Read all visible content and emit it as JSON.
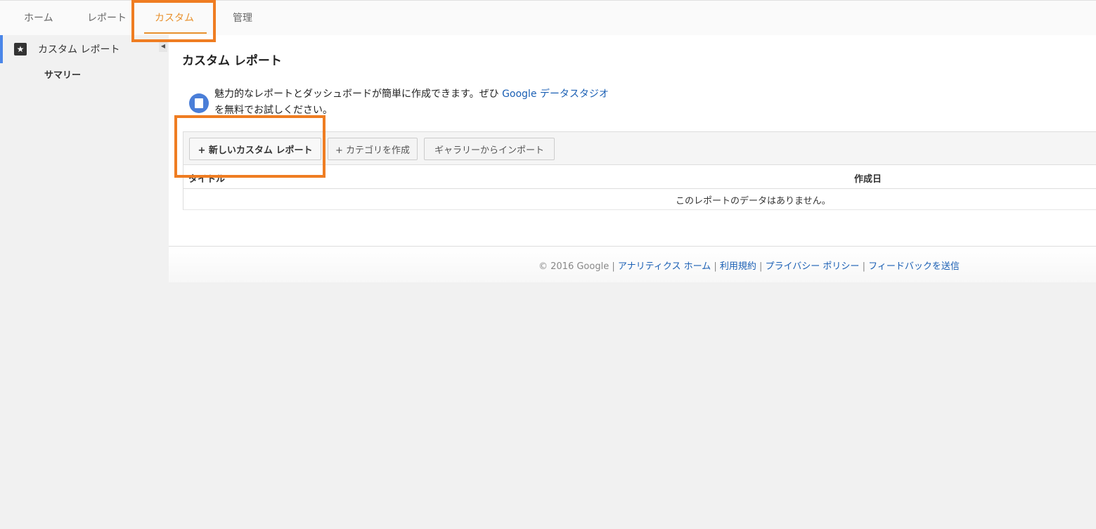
{
  "nav": {
    "tabs": [
      {
        "label": "ホーム"
      },
      {
        "label": "レポート"
      },
      {
        "label": "カスタム"
      },
      {
        "label": "管理"
      }
    ]
  },
  "sidebar": {
    "section_label": "カスタム レポート",
    "sub_item": "サマリー"
  },
  "main": {
    "title": "カスタム レポート",
    "promo_text_1": "魅力的なレポートとダッシュボードが簡単に作成できます。ぜひ ",
    "promo_link": "Google データスタジオ",
    "promo_text_2": "を無料でお試しください。",
    "buttons": {
      "new_report": "+ 新しいカスタム レポート",
      "create_category": "+ カテゴリを作成",
      "import_gallery": "ギャラリーからインポート"
    },
    "table": {
      "col_title": "タイトル",
      "col_created": "作成日",
      "empty_message": "このレポートのデータはありません。"
    }
  },
  "footer": {
    "copyright": "© 2016 Google",
    "links": [
      "アナリティクス ホーム",
      "利用規約",
      "プライバシー ポリシー",
      "フィードバックを送信"
    ],
    "separator": "|"
  },
  "colors": {
    "accent_orange": "#e8912e",
    "highlight_box": "#ef7d22",
    "link_blue": "#1a5fb4",
    "sidebar_active": "#4a86e8"
  }
}
